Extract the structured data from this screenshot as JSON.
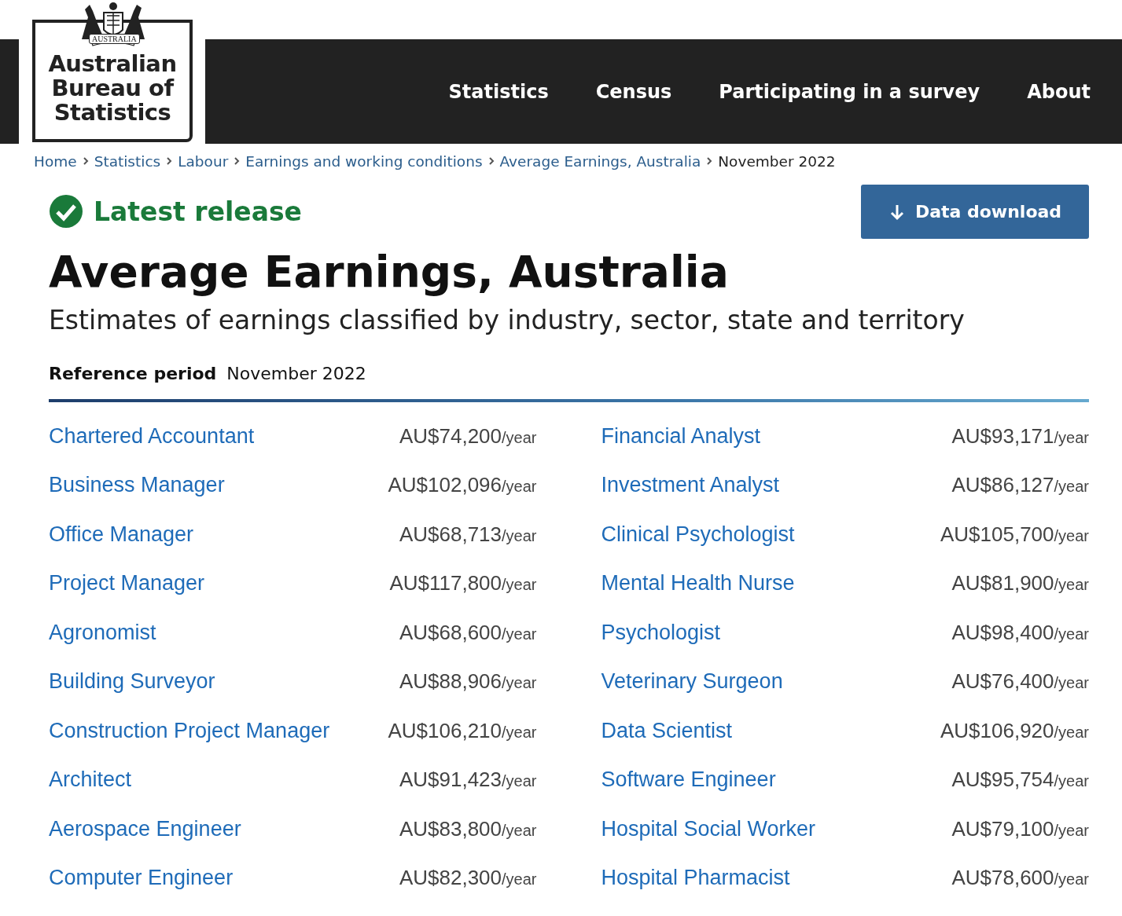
{
  "logo": {
    "crest_text": "AUSTRALIA",
    "name": [
      "Australian",
      "Bureau of",
      "Statistics"
    ]
  },
  "nav": [
    {
      "label": "Statistics"
    },
    {
      "label": "Census"
    },
    {
      "label": "Participating in a survey"
    },
    {
      "label": "About"
    }
  ],
  "breadcrumbs": [
    {
      "label": "Home",
      "current": false
    },
    {
      "label": "Statistics",
      "current": false
    },
    {
      "label": "Labour",
      "current": false
    },
    {
      "label": "Earnings and working conditions",
      "current": false
    },
    {
      "label": "Average Earnings, Australia",
      "current": false
    },
    {
      "label": "November 2022",
      "current": true
    }
  ],
  "status": {
    "label": "Latest release"
  },
  "download_button": {
    "label": "Data download"
  },
  "title": "Average Earnings, Australia",
  "subtitle": "Estimates of earnings classified by industry, sector, state and territory",
  "reference_period": {
    "label": "Reference period",
    "value": "November 2022"
  },
  "columns": [
    {
      "items": [
        {
          "title": "Chartered Accountant",
          "amount": "AU$74,200",
          "unit": "/year"
        },
        {
          "title": "Business Manager",
          "amount": "AU$102,096",
          "unit": "/year"
        },
        {
          "title": "Office Manager",
          "amount": "AU$68,713",
          "unit": "/year"
        },
        {
          "title": "Project Manager",
          "amount": "AU$117,800",
          "unit": "/year"
        },
        {
          "title": "Agronomist",
          "amount": "AU$68,600",
          "unit": "/year"
        },
        {
          "title": "Building Surveyor",
          "amount": "AU$88,906",
          "unit": "/year"
        },
        {
          "title": "Construction Project Manager",
          "amount": "AU$106,210",
          "unit": "/year"
        },
        {
          "title": "Architect",
          "amount": "AU$91,423",
          "unit": "/year"
        },
        {
          "title": "Aerospace Engineer",
          "amount": "AU$83,800",
          "unit": "/year"
        },
        {
          "title": "Computer Engineer",
          "amount": "AU$82,300",
          "unit": "/year"
        }
      ]
    },
    {
      "items": [
        {
          "title": "Financial Analyst",
          "amount": "AU$93,171",
          "unit": "/year"
        },
        {
          "title": "Investment Analyst",
          "amount": "AU$86,127",
          "unit": "/year"
        },
        {
          "title": "Clinical Psychologist",
          "amount": "AU$105,700",
          "unit": "/year"
        },
        {
          "title": "Mental Health Nurse",
          "amount": "AU$81,900",
          "unit": "/year"
        },
        {
          "title": "Psychologist",
          "amount": "AU$98,400",
          "unit": "/year"
        },
        {
          "title": "Veterinary Surgeon",
          "amount": "AU$76,400",
          "unit": "/year"
        },
        {
          "title": "Data Scientist",
          "amount": "AU$106,920",
          "unit": "/year"
        },
        {
          "title": "Software Engineer",
          "amount": "AU$95,754",
          "unit": "/year"
        },
        {
          "title": "Hospital Social Worker",
          "amount": "AU$79,100",
          "unit": "/year"
        },
        {
          "title": "Hospital Pharmacist",
          "amount": "AU$78,600",
          "unit": "/year"
        }
      ]
    }
  ]
}
